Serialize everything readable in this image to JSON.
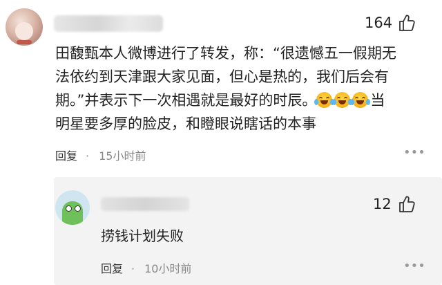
{
  "comment": {
    "like_count": "164",
    "lines": [
      "田馥甄本人微博进行了转发，称：“很遗憾五一假期无",
      "法依约到天津跟大家见面，但心是热的，我们后会有",
      "期。”并表示下一次相遇就是最好的时辰。",
      "明星要多厚的脸皮，和瞪眼说瞎话的本事"
    ],
    "line3_tail": "当",
    "emoji_name": "laughing-crying-face",
    "reply_label": "回复",
    "time": "15小时前"
  },
  "reply": {
    "like_count": "12",
    "text": "捞钱计划失败",
    "reply_label": "回复",
    "time": "10小时前"
  },
  "colors": {
    "background": "#ffffff",
    "reply_bg": "#f3f3f3",
    "text": "#222222",
    "meta_text": "#888888"
  }
}
